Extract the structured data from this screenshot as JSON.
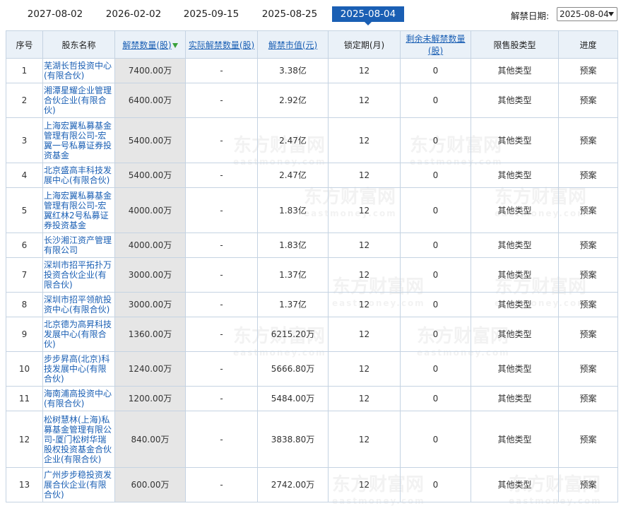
{
  "date_tabs": [
    {
      "label": "2027-08-02",
      "active": false
    },
    {
      "label": "2026-02-02",
      "active": false
    },
    {
      "label": "2025-09-15",
      "active": false
    },
    {
      "label": "2025-08-25",
      "active": false
    },
    {
      "label": "2025-08-04",
      "active": true
    }
  ],
  "selector": {
    "label": "解禁日期:",
    "value": "2025-08-04"
  },
  "columns": [
    "序号",
    "股东名称",
    "解禁数量(股)",
    "实际解禁数量(股)",
    "解禁市值(元)",
    "锁定期(月)",
    "剩余未解禁数量(股)",
    "限售股类型",
    "进度"
  ],
  "watermark": {
    "cn": "东方财富网",
    "en": "eastmoney.com"
  },
  "rows": [
    [
      "1",
      "芜湖长哲投资中心(有限合伙)",
      "7400.00万",
      "-",
      "3.38亿",
      "12",
      "0",
      "其他类型",
      "预案"
    ],
    [
      "2",
      "湘潭星耀企业管理合伙企业(有限合伙)",
      "6400.00万",
      "-",
      "2.92亿",
      "12",
      "0",
      "其他类型",
      "预案"
    ],
    [
      "3",
      "上海宏翼私募基金管理有限公司-宏翼一号私募证券投资基金",
      "5400.00万",
      "-",
      "2.47亿",
      "12",
      "0",
      "其他类型",
      "预案"
    ],
    [
      "4",
      "北京盛高丰科技发展中心(有限合伙)",
      "5400.00万",
      "-",
      "2.47亿",
      "12",
      "0",
      "其他类型",
      "预案"
    ],
    [
      "5",
      "上海宏翼私募基金管理有限公司-宏翼红林2号私募证券投资基金",
      "4000.00万",
      "-",
      "1.83亿",
      "12",
      "0",
      "其他类型",
      "预案"
    ],
    [
      "6",
      "长沙湘江资产管理有限公司",
      "4000.00万",
      "-",
      "1.83亿",
      "12",
      "0",
      "其他类型",
      "预案"
    ],
    [
      "7",
      "深圳市招平拓扑万投资合伙企业(有限合伙)",
      "3000.00万",
      "-",
      "1.37亿",
      "12",
      "0",
      "其他类型",
      "预案"
    ],
    [
      "8",
      "深圳市招平领航投资中心(有限合伙)",
      "3000.00万",
      "-",
      "1.37亿",
      "12",
      "0",
      "其他类型",
      "预案"
    ],
    [
      "9",
      "北京德为高昇科技发展中心(有限合伙)",
      "1360.00万",
      "-",
      "6215.20万",
      "12",
      "0",
      "其他类型",
      "预案"
    ],
    [
      "10",
      "步步昇高(北京)科技发展中心(有限合伙)",
      "1240.00万",
      "-",
      "5666.80万",
      "12",
      "0",
      "其他类型",
      "预案"
    ],
    [
      "11",
      "海南浦高投资中心(有限合伙)",
      "1200.00万",
      "-",
      "5484.00万",
      "12",
      "0",
      "其他类型",
      "预案"
    ],
    [
      "12",
      "松树慧林(上海)私募基金管理有限公司-厦门松树华瑞股权投资基金合伙企业(有限合伙)",
      "840.00万",
      "-",
      "3838.80万",
      "12",
      "0",
      "其他类型",
      "预案"
    ],
    [
      "13",
      "广州步步稳投资发展合伙企业(有限合伙)",
      "600.00万",
      "-",
      "2742.00万",
      "12",
      "0",
      "其他类型",
      "预案"
    ]
  ]
}
